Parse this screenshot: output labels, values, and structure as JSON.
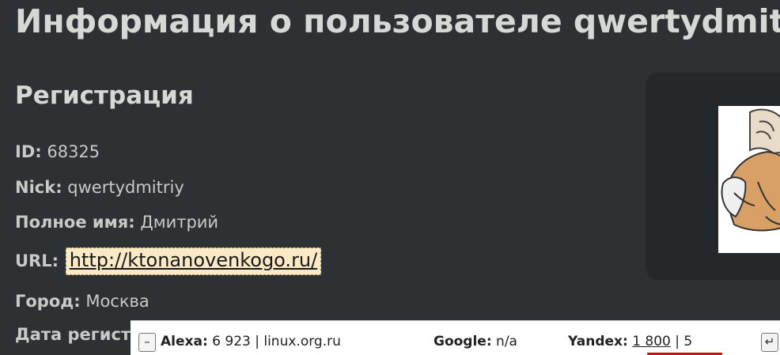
{
  "page": {
    "title": "Информация о пользователе qwertydmitriy"
  },
  "registration": {
    "heading": "Регистрация",
    "id_label": "ID:",
    "id_value": "68325",
    "nick_label": "Nick:",
    "nick_value": "qwertydmitriy",
    "fullname_label": "Полное имя:",
    "fullname_value": "Дмитрий",
    "url_label": "URL:",
    "url_value": "http://ktonanovenkogo.ru/",
    "city_label": "Город:",
    "city_value": "Москва",
    "regdate_label": "Дата регистрации"
  },
  "seo_bar": {
    "collapse_icon": "–",
    "alexa_label": "Alexa:",
    "alexa_value": "6 923 | linux.org.ru",
    "google_label": "Google:",
    "google_value": "n/a",
    "yandex_label": "Yandex:",
    "yandex_value": "1 800",
    "separator": "|",
    "extra_value": "5",
    "enter_icon": "↵"
  },
  "colors": {
    "background": "#2e3133",
    "text": "#c8cac7",
    "url_highlight": "#fce9c5",
    "avatar_panel": "#25282a",
    "seo_bar": "#ffffff",
    "red_mark": "#c4121a"
  },
  "icons": {
    "avatar": "user-avatar-caricature",
    "collapse": "minus-box-icon",
    "enter": "enter-arrow-icon"
  }
}
